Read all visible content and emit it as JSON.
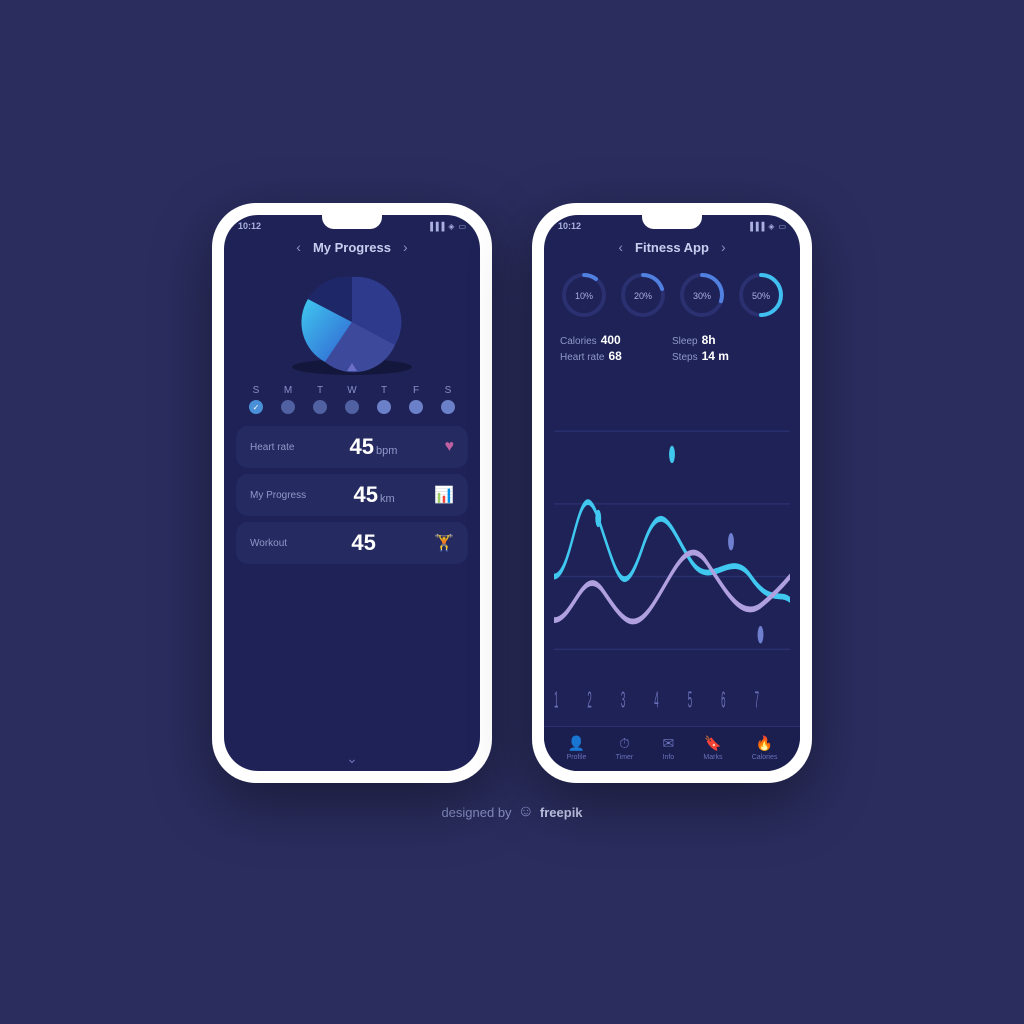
{
  "phone1": {
    "status_time": "10:12",
    "header_title": "My Progress",
    "week_days": [
      "S",
      "M",
      "T",
      "W",
      "T",
      "F",
      "S"
    ],
    "week_dot_states": [
      "check",
      "filled",
      "filled",
      "filled",
      "light",
      "light",
      "light"
    ],
    "metrics": [
      {
        "label": "Heart rate",
        "value": "45",
        "unit": "bpm",
        "icon": "♥"
      },
      {
        "label": "My Progress",
        "value": "45",
        "unit": "km",
        "icon": "📊"
      },
      {
        "label": "Workout",
        "value": "45",
        "unit": "",
        "icon": "🏋"
      }
    ]
  },
  "phone2": {
    "status_time": "10:12",
    "header_title": "Fitness App",
    "rings": [
      {
        "pct": "10%",
        "value": 10
      },
      {
        "pct": "20%",
        "value": 20
      },
      {
        "pct": "30%",
        "value": 30
      },
      {
        "pct": "50%",
        "value": 50
      }
    ],
    "stats": [
      {
        "label": "Calories",
        "value": "400"
      },
      {
        "label": "Sleep",
        "value": "8h"
      },
      {
        "label": "Heart rate",
        "value": "68"
      },
      {
        "label": "Steps",
        "value": "14 m"
      }
    ],
    "chart_x": [
      "1",
      "2",
      "3",
      "4",
      "5",
      "6",
      "7"
    ],
    "nav_items": [
      {
        "label": "Profile",
        "icon": "👤"
      },
      {
        "label": "Timer",
        "icon": "⏱"
      },
      {
        "label": "Info",
        "icon": "✉"
      },
      {
        "label": "Marks",
        "icon": "🔖"
      },
      {
        "label": "Calories",
        "icon": "🔥"
      }
    ]
  },
  "footer": {
    "text": "designed by",
    "brand": "freepik"
  }
}
